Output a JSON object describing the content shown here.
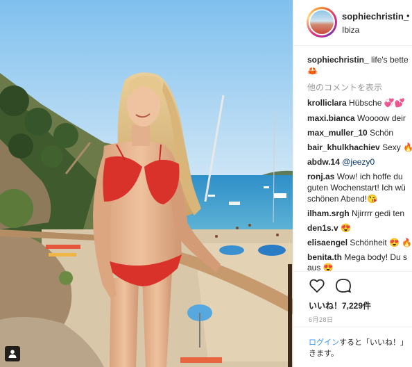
{
  "post": {
    "username": "sophiechristin_",
    "follow_dot": "•",
    "location": "Ibiza",
    "caption_user": "sophiechristin_",
    "caption_text": "life's bette",
    "caption_emoji": "🦀",
    "view_more_comments": "他のコメントを表示",
    "comments": [
      {
        "user": "krolliclara",
        "text": "Hübsche 💞💕"
      },
      {
        "user": "maxi.bianca",
        "text": "Woooow deir"
      },
      {
        "user": "max_muller_10",
        "text": "Schön"
      },
      {
        "user": "bair_khulkhachiev",
        "text": "Sexy 🔥"
      },
      {
        "user": "abdw.14",
        "mention": "@jeezy0"
      },
      {
        "user": "ronj.as",
        "text": "Wow! ich hoffe du",
        "line2": "guten Wochenstart! Ich wü",
        "line3": "schönen Abend!😘"
      },
      {
        "user": "ilham.srgh",
        "text": "Njirrrr gedi ten"
      },
      {
        "user": "den1s.v",
        "text": "😍"
      },
      {
        "user": "elisaengel",
        "text": "Schönheit 😍 🔥"
      },
      {
        "user": "benita.th",
        "text": "Mega body! Du s",
        "line2": "aus 😍"
      }
    ],
    "likes": "いいね！7,229件",
    "date": "6月28日",
    "login_link": "ログイン",
    "login_text_1": "すると「いいね！」",
    "login_text_2": "きます。"
  },
  "icons": {
    "like": "heart-outline-icon",
    "comment": "speech-bubble-icon",
    "tag": "person-tag-icon"
  },
  "colors": {
    "link_blue": "#3897f0",
    "muted_gray": "#999999",
    "text_dark": "#262626",
    "mention_blue": "#003569"
  }
}
